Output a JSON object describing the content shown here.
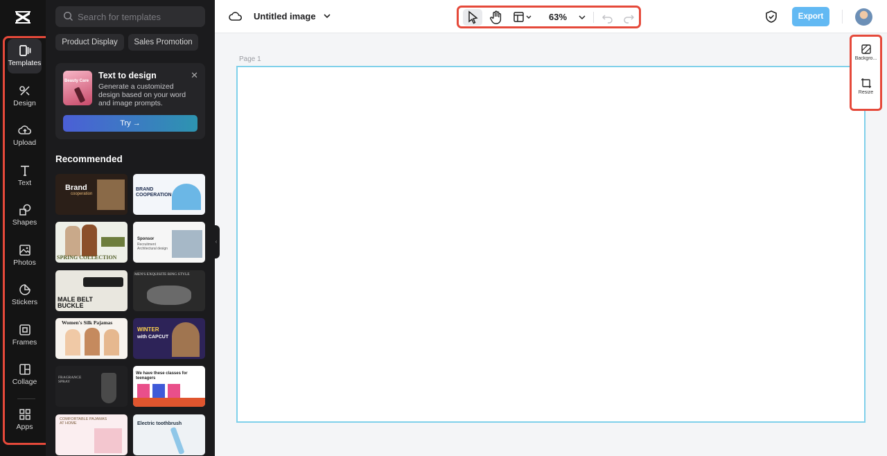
{
  "brand": {
    "logo_icon": "capcut-logo-icon"
  },
  "rail": {
    "items": [
      {
        "label": "Templates",
        "icon": "templates-icon",
        "active": true
      },
      {
        "label": "Design",
        "icon": "design-icon"
      },
      {
        "label": "Upload",
        "icon": "upload-cloud-icon"
      },
      {
        "label": "Text",
        "icon": "text-icon"
      },
      {
        "label": "Shapes",
        "icon": "shapes-icon"
      },
      {
        "label": "Photos",
        "icon": "photos-icon"
      },
      {
        "label": "Stickers",
        "icon": "stickers-icon"
      },
      {
        "label": "Frames",
        "icon": "frames-icon"
      },
      {
        "label": "Collage",
        "icon": "collage-icon"
      },
      {
        "label": "Apps",
        "icon": "apps-icon"
      }
    ]
  },
  "panel": {
    "search_placeholder": "Search for templates",
    "chips": [
      "Product Display",
      "Sales Promotion"
    ],
    "promo": {
      "thumb_text": "Beauty Care",
      "title": "Text to design",
      "description": "Generate a customized design based on your word and image prompts.",
      "button": "Try →"
    },
    "recommended_title": "Recommended",
    "templates": [
      {
        "label": "Brand",
        "sub": "cooperation"
      },
      {
        "label": "BRAND COOPERATION",
        "sub": ""
      },
      {
        "label": "SPRING COLLECTION",
        "sub": ""
      },
      {
        "label": "Sponsor",
        "sub": "Recruitment Architectural design"
      },
      {
        "label": "MALE BELT BUCKLE",
        "sub": ""
      },
      {
        "label": "MEN'S EXQUISITE RING STYLE",
        "sub": ""
      },
      {
        "label": "Women's Silk Pajamas",
        "sub": ""
      },
      {
        "label": "WINTER",
        "sub": "with CAPCUT"
      },
      {
        "label": "FRAGRANCE SPRAY",
        "sub": ""
      },
      {
        "label": "We have these classes for teenagers",
        "sub": ""
      },
      {
        "label": "COMFORTABLE PAJAMAS AT HOME",
        "sub": ""
      },
      {
        "label": "Electric toothbrush",
        "sub": ""
      }
    ]
  },
  "topbar": {
    "doc_title": "Untitled image",
    "zoom": "63%",
    "export": "Export"
  },
  "canvas": {
    "page_label": "Page 1"
  },
  "right_panel": {
    "items": [
      {
        "label": "Backgro...",
        "icon": "background-icon"
      },
      {
        "label": "Resize",
        "icon": "resize-icon"
      }
    ]
  },
  "colors": {
    "accent": "#62b9f3",
    "highlight": "#e5493a",
    "canvas_border": "#7fd0ea"
  }
}
